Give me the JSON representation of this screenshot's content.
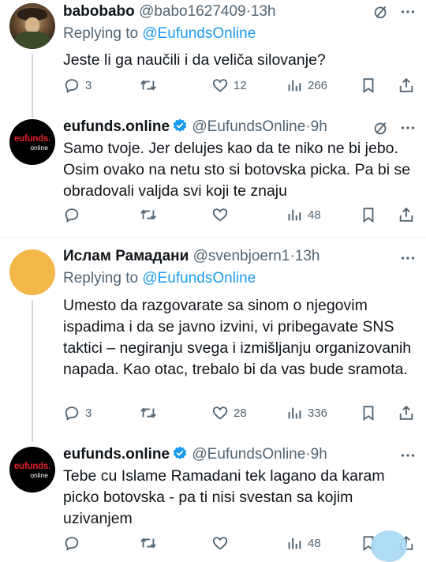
{
  "tweets": [
    {
      "name": "babobabo",
      "handle": "@babo1627409",
      "sep": "·",
      "time": "13h",
      "replying_prefix": "Replying to ",
      "replying_to": "@EufundsOnline",
      "text": "Jeste li ga naučili i da veliča silovanje?",
      "replies": "3",
      "retweets": "",
      "likes": "12",
      "views": "266"
    },
    {
      "name": "eufunds.online",
      "handle": "@EufundsOnline",
      "sep": "·",
      "time": "9h",
      "avatar_brand": "eufunds.",
      "avatar_sub": "online",
      "text": "Samo tvoje. Jer delujes kao da te niko ne bi jebo. Osim ovako na netu sto si botovska picka. Pa bi se obradovali valjda svi koji te znaju",
      "replies": "",
      "retweets": "",
      "likes": "",
      "views": "48"
    },
    {
      "name": "Ислам Рамадани",
      "handle": "@svenbjoern1",
      "sep": "·",
      "time": "13h",
      "replying_prefix": "Replying to ",
      "replying_to": "@EufundsOnline",
      "text": "Umesto da razgovarate sa sinom o njegovim ispadima i da se javno izvini, vi pribegavate SNS taktici – negiranju svega i izmišljanju organizovanih napada. Kao otac, trebalo bi da vas bude sramota.",
      "replies": "3",
      "retweets": "",
      "likes": "28",
      "views": "336"
    },
    {
      "name": "eufunds.online",
      "handle": "@EufundsOnline",
      "sep": "·",
      "time": "9h",
      "avatar_brand": "eufunds.",
      "avatar_sub": "online",
      "text": "Tebe cu Islame Ramadani tek lagano da karam picko botovska - pa ti nisi svestan sa kojim uzivanjem",
      "replies": "",
      "retweets": "",
      "likes": "",
      "views": "48"
    }
  ],
  "colors": {
    "accent": "#1d9bf0",
    "muted": "#536471",
    "text": "#0f1419",
    "brand_red": "#e0202a"
  },
  "icons": [
    "grok-icon",
    "more-icon",
    "reply-icon",
    "retweet-icon",
    "like-icon",
    "views-icon",
    "bookmark-icon",
    "share-icon",
    "verified-badge-icon"
  ]
}
